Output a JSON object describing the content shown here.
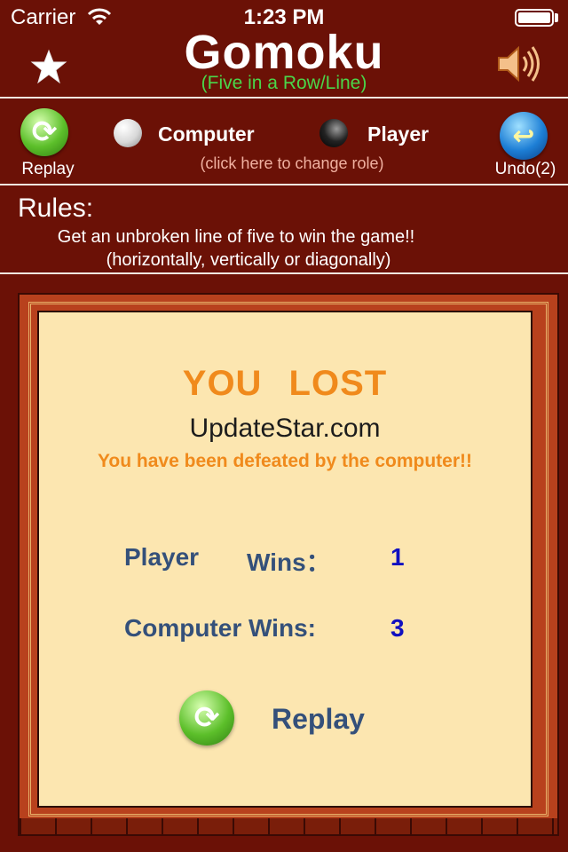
{
  "status_bar": {
    "carrier": "Carrier",
    "time": "1:23 PM"
  },
  "header": {
    "title": "Gomoku",
    "subtitle": "(Five in a Row/Line)"
  },
  "controls": {
    "replay_label": "Replay",
    "undo_label": "Undo(2)",
    "computer_label": "Computer",
    "player_label": "Player",
    "change_role": "(click here to change role)"
  },
  "rules": {
    "title": "Rules:",
    "line1": "Get an unbroken line of five  to win the game!!",
    "line2": "(horizontally, vertically or diagonally)"
  },
  "result": {
    "headline": "YOU   LOST",
    "watermark": "UpdateStar.com",
    "message": "You have been defeated by the computer!!",
    "player_label": "Player",
    "wins_label": "Wins：",
    "player_wins": "1",
    "computer_label": "Computer Wins:",
    "computer_wins": "3",
    "replay_label": "Replay"
  },
  "icons": {
    "star": "star-icon",
    "sound": "speaker-icon",
    "replay": "refresh-icon",
    "undo": "undo-arrow-icon",
    "wifi": "wifi-icon",
    "battery": "battery-icon"
  },
  "colors": {
    "background": "#6b1106",
    "subtitle": "#4ad64a",
    "accent_orange": "#f08a1c",
    "stat_text": "#34507a",
    "stat_number": "#1010c0",
    "board_paper": "#fce6b0"
  }
}
